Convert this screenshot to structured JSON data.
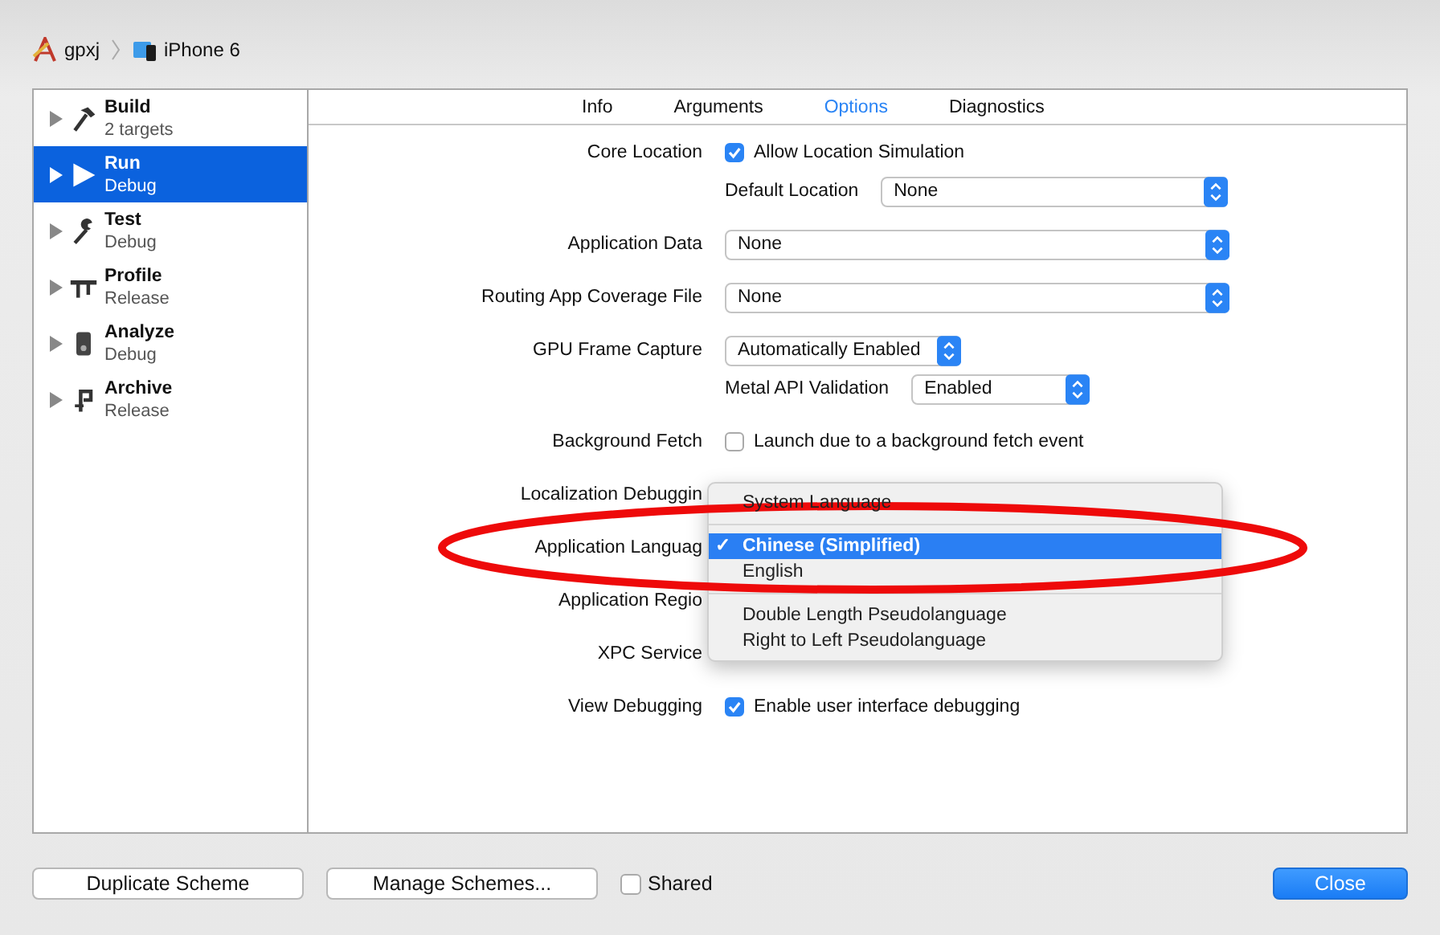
{
  "breadcrumb": {
    "project": "gpxj",
    "device": "iPhone 6"
  },
  "sidebar": {
    "items": [
      {
        "name": "Build",
        "detail": "2 targets",
        "selected": false
      },
      {
        "name": "Run",
        "detail": "Debug",
        "selected": true
      },
      {
        "name": "Test",
        "detail": "Debug",
        "selected": false
      },
      {
        "name": "Profile",
        "detail": "Release",
        "selected": false
      },
      {
        "name": "Analyze",
        "detail": "Debug",
        "selected": false
      },
      {
        "name": "Archive",
        "detail": "Release",
        "selected": false
      }
    ]
  },
  "tabs": [
    {
      "label": "Info",
      "selected": false
    },
    {
      "label": "Arguments",
      "selected": false
    },
    {
      "label": "Options",
      "selected": true
    },
    {
      "label": "Diagnostics",
      "selected": false
    }
  ],
  "rows": [
    {
      "kind": "checkbox",
      "label": "Core Location",
      "text": "Allow Location Simulation",
      "checked": true
    },
    {
      "kind": "sub_popup",
      "label": "Default Location",
      "value": "None"
    },
    {
      "kind": "popup",
      "label": "Application Data",
      "value": "None"
    },
    {
      "kind": "popup",
      "label": "Routing App Coverage File",
      "value": "None"
    },
    {
      "kind": "compact_popup",
      "label": "GPU Frame Capture",
      "value": "Automatically Enabled"
    },
    {
      "kind": "sub_compact_popup",
      "label": "Metal API Validation",
      "value": "Enabled"
    },
    {
      "kind": "checkbox",
      "label": "Background Fetch",
      "text": "Launch due to a background fetch event",
      "checked": false
    },
    {
      "kind": "covered",
      "label": "Localization Debuggin"
    },
    {
      "kind": "covered",
      "label": "Application Languag"
    },
    {
      "kind": "covered",
      "label": "Application Regio"
    },
    {
      "kind": "covered",
      "label": "XPC Service"
    },
    {
      "kind": "checkbox",
      "label": "View Debugging",
      "text": "Enable user interface debugging",
      "checked": true
    }
  ],
  "menu": {
    "items": [
      {
        "kind": "item",
        "label": "System Language",
        "selected": false
      },
      {
        "kind": "separator"
      },
      {
        "kind": "item",
        "label": "Chinese (Simplified)",
        "selected": true,
        "mark": "✓"
      },
      {
        "kind": "item",
        "label": "English",
        "selected": false
      },
      {
        "kind": "separator"
      },
      {
        "kind": "item",
        "label": "Double Length Pseudolanguage",
        "selected": false
      },
      {
        "kind": "item",
        "label": "Right to Left Pseudolanguage",
        "selected": false
      }
    ]
  },
  "footer": {
    "buttons": [
      "Duplicate Scheme",
      "Manage Schemes..."
    ],
    "shared": {
      "label": "Shared",
      "checked": false
    },
    "close": "Close"
  }
}
